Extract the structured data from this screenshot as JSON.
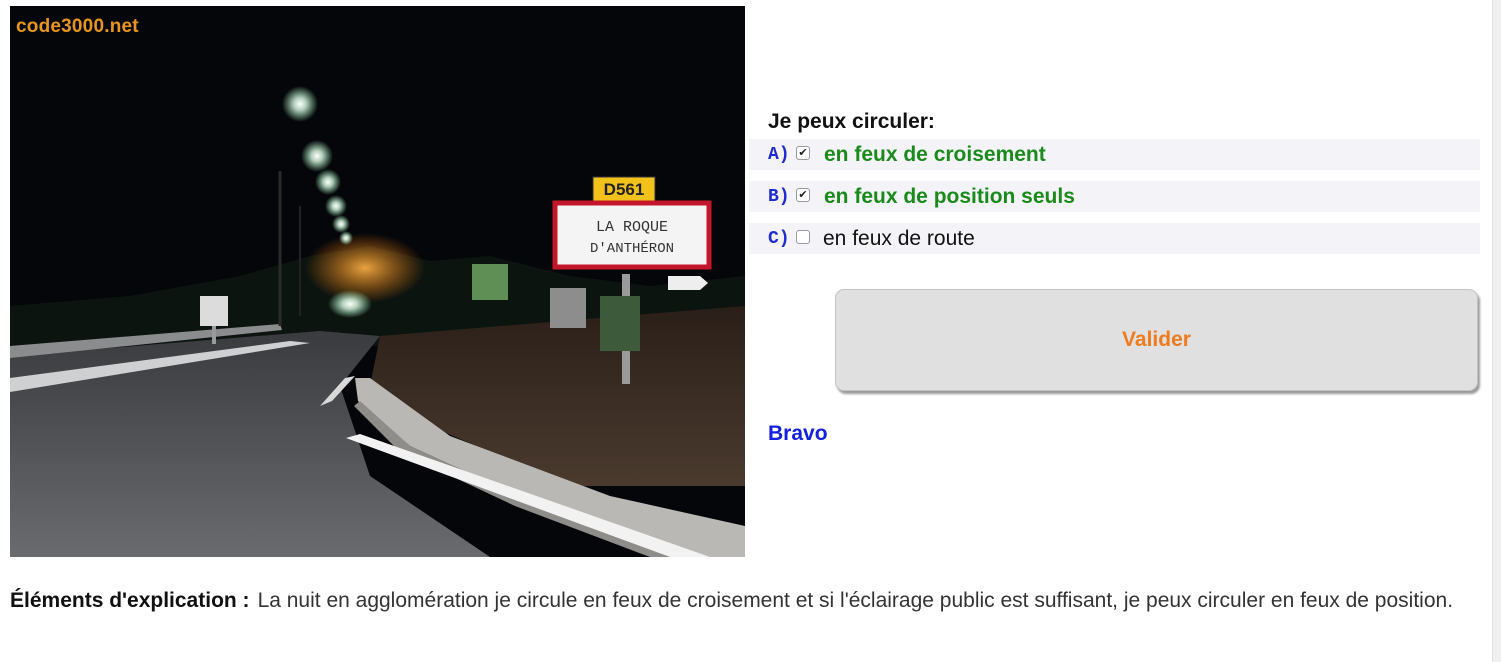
{
  "photo": {
    "watermark": "code3000.net",
    "road_sign_number": "D561",
    "town_sign_line1": "LA ROQUE",
    "town_sign_line2": "D'ANTHÉRON"
  },
  "question": {
    "title": "Je peux circuler:",
    "answers": [
      {
        "letter": "A)",
        "text": "en feux de croisement",
        "checked": true,
        "correct": true
      },
      {
        "letter": "B)",
        "text": "en feux de position seuls",
        "checked": true,
        "correct": true
      },
      {
        "letter": "C)",
        "text": "en feux de route",
        "checked": false,
        "correct": false
      }
    ],
    "validate_label": "Valider",
    "result": "Bravo"
  },
  "explanation": {
    "label": "Éléments d'explication :",
    "text": "La nuit en agglomération je circule en feux de croisement et si l'éclairage public est suffisant, je peux circuler en feux de position."
  },
  "colors": {
    "correct_answer": "#1a8a1a",
    "answer_letter": "#1e2bd0",
    "validate_text": "#f07a1e",
    "result_text": "#1420e0",
    "watermark": "#e8961e"
  }
}
